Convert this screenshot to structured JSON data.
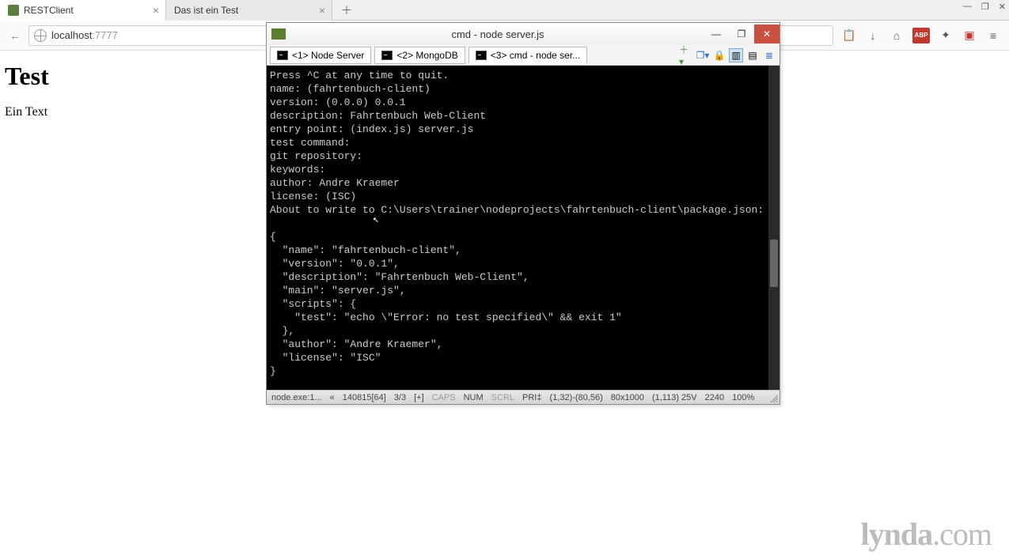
{
  "browser": {
    "tabs": [
      {
        "label": "RESTClient",
        "active": true,
        "has_icon": true
      },
      {
        "label": "Das ist ein Test",
        "active": false,
        "has_icon": false
      }
    ],
    "url_host": "localhost",
    "url_port": ":7777",
    "back_icon": "←",
    "globe_icon": "globe",
    "toolbar": {
      "clipboard": "📋",
      "download": "↓",
      "home": "⌂",
      "adblock": "ABP",
      "wand": "✦",
      "pocket": "▣",
      "menu": "≡"
    },
    "window": {
      "min": "—",
      "max": "❐",
      "close": "✕"
    }
  },
  "page": {
    "heading": "Test",
    "body": "Ein Text"
  },
  "terminal": {
    "title": "cmd - node  server.js",
    "win_min": "—",
    "win_max": "❐",
    "win_close": "✕",
    "tabs": [
      {
        "label": "<1> Node Server",
        "active": false
      },
      {
        "label": "<2> MongoDB",
        "active": false
      },
      {
        "label": "<3> cmd - node  ser...",
        "active": true
      }
    ],
    "tools": {
      "add": "＋▾",
      "copy": "❐▾",
      "lock": "🔒",
      "split1": "▥",
      "split2": "▤",
      "list": "≣"
    },
    "lines": [
      "Press ^C at any time to quit.",
      "name: (fahrtenbuch-client)",
      "version: (0.0.0) 0.0.1",
      "description: Fahrtenbuch Web-Client",
      "entry point: (index.js) server.js",
      "test command:",
      "git repository:",
      "keywords:",
      "author: Andre Kraemer",
      "license: (ISC)",
      "About to write to C:\\Users\\trainer\\nodeprojects\\fahrtenbuch-client\\package.json:",
      "",
      "{",
      "  \"name\": \"fahrtenbuch-client\",",
      "  \"version\": \"0.0.1\",",
      "  \"description\": \"Fahrtenbuch Web-Client\",",
      "  \"main\": \"server.js\",",
      "  \"scripts\": {",
      "    \"test\": \"echo \\\"Error: no test specified\\\" && exit 1\"",
      "  },",
      "  \"author\": \"Andre Kraemer\",",
      "  \"license\": \"ISC\"",
      "}"
    ],
    "status": {
      "proc": "node.exe:1...",
      "chev": "«",
      "buf": "140815[64]",
      "frac": "3/3",
      "plus": "[+]",
      "caps": "CAPS",
      "num": "NUM",
      "scrl": "SCRL",
      "pri": "PRI‡",
      "sel": "(1,32)-(80,56)",
      "dim": "80x1000",
      "pos": "(1,113) 25V",
      "t": "2240",
      "zoom": "100%"
    }
  },
  "watermark": {
    "brand": "lynda",
    "suffix": ".com"
  }
}
